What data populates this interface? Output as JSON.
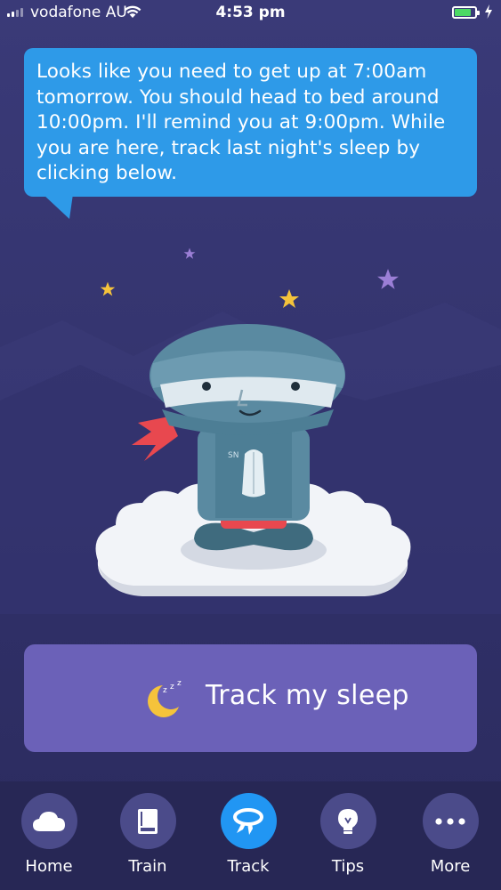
{
  "status_bar": {
    "carrier": "vodafone AU",
    "time": "4:53 pm"
  },
  "bubble": {
    "message": "Looks like you need to get up at 7:00am tomorrow. You should head to bed around 10:00pm. I'll remind you at 9:00pm. While you are here, track last night's sleep by clicking below."
  },
  "character": {
    "badge": "SN"
  },
  "track_button": {
    "label": "Track my sleep",
    "icon": "sleeping-moon-icon"
  },
  "tabs": [
    {
      "label": "Home",
      "icon": "cloud-icon",
      "active": false
    },
    {
      "label": "Train",
      "icon": "book-icon",
      "active": false
    },
    {
      "label": "Track",
      "icon": "headband-icon",
      "active": true
    },
    {
      "label": "Tips",
      "icon": "lightbulb-icon",
      "active": false
    },
    {
      "label": "More",
      "icon": "more-dots-icon",
      "active": false
    }
  ],
  "colors": {
    "background": "#34346e",
    "bubble": "#2e9ae8",
    "track_button": "#6b61b8",
    "tab_active": "#2196f3",
    "tab_inactive": "#4b4b8a"
  }
}
